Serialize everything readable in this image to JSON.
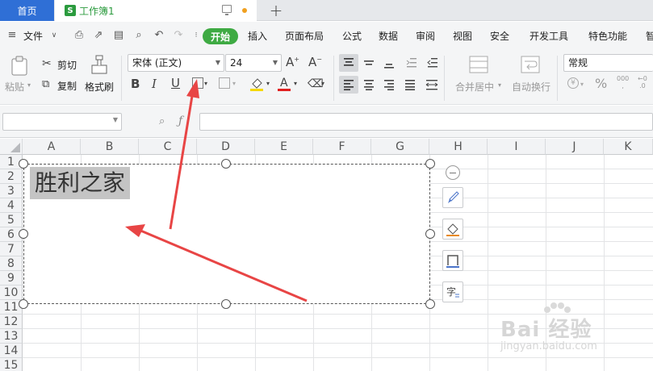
{
  "tabs": {
    "home": "首页",
    "doc": "工作簿1"
  },
  "menu": {
    "file": "文件",
    "start": "开始",
    "items": [
      "插入",
      "页面布局",
      "公式",
      "数据",
      "审阅",
      "视图",
      "安全",
      "开发工具",
      "特色功能",
      "智"
    ]
  },
  "ribbon": {
    "paste": "粘贴",
    "cut": "剪切",
    "copy": "复制",
    "format_painter": "格式刷",
    "font_name": "宋体 (正文)",
    "font_size": "24",
    "merge_center": "合并居中",
    "wrap_text": "自动换行",
    "number_format": "常规",
    "percent": "%",
    "thousands": "000",
    "decimal": "←0"
  },
  "columns": [
    "A",
    "B",
    "C",
    "D",
    "E",
    "F",
    "G",
    "H",
    "I",
    "J",
    "K"
  ],
  "rows": [
    "1",
    "2",
    "3",
    "4",
    "5",
    "6",
    "7",
    "8",
    "9",
    "10",
    "11",
    "12",
    "13",
    "14",
    "15"
  ],
  "textbox": {
    "text": "胜利之家"
  },
  "watermark": {
    "brand": "Bai 经验",
    "url": "jingyan.baidu.com"
  },
  "colors": {
    "accent_blue": "#2f6fd6",
    "start_green": "#3eaa43",
    "arrow_red": "#e84545"
  }
}
